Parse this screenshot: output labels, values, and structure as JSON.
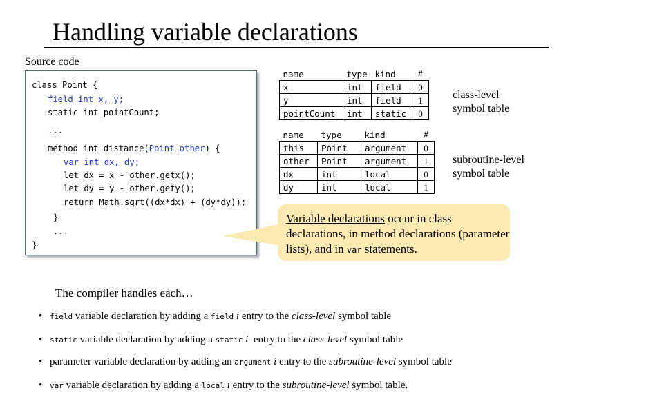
{
  "title": "Handling variable declarations",
  "source_label": "Source code",
  "code_lines": [
    "class Point {",
    "field int x, y;",
    "static int pointCount;",
    "...",
    "method int distance(",
    "Point other",
    ") {",
    "var int dx, dy;",
    "let dx = x - other.getx();",
    "let dy = y - other.gety();",
    "return Math.sqrt((dx*dx) + (dy*dy));",
    "}",
    "...",
    "}"
  ],
  "class_table": {
    "headers": [
      "name",
      "type",
      "kind",
      "#"
    ],
    "rows": [
      [
        "x",
        "int",
        "field",
        "0"
      ],
      [
        "y",
        "int",
        "field",
        "1"
      ],
      [
        "pointCount",
        "int",
        "static",
        "0"
      ]
    ],
    "label_line1": "class-level",
    "label_line2": "symbol table"
  },
  "sub_table": {
    "headers": [
      "name",
      "type",
      "kind",
      "#"
    ],
    "rows": [
      [
        "this",
        "Point",
        "argument",
        "0"
      ],
      [
        "other",
        "Point",
        "argument",
        "1"
      ],
      [
        "dx",
        "int",
        "local",
        "0"
      ],
      [
        "dy",
        "int",
        "local",
        "1"
      ]
    ],
    "label_line1": "subroutine-level",
    "label_line2": "symbol table"
  },
  "callout": {
    "underlined": "Variable declarations",
    "text1": " occur in class declarations, in method declarations (parameter lists), and in ",
    "code": "var",
    "text2": " statements.",
    "fill_color": "#fde9b2"
  },
  "intro": "The compiler handles each…",
  "bullets": [
    {
      "code1": "field",
      "t1": " variable declaration by adding a ",
      "code2": "field",
      "i": " i",
      "t2": " entry to the ",
      "em": "class-level",
      "t3": " symbol table"
    },
    {
      "code1": "static",
      "t1": " variable declaration by adding a ",
      "code2": "static",
      "i": " i",
      "t2": "  entry to the ",
      "em": "class-level",
      "t3": " symbol table"
    },
    {
      "code1": "",
      "t1": "parameter variable declaration by adding an ",
      "code2": "argument",
      "i": " i",
      "t2": " entry to the ",
      "em": "subroutine-level",
      "t3": " symbol table"
    },
    {
      "code1": "var",
      "t1": " variable declaration by adding a ",
      "code2": "local",
      "i": " i",
      "t2": " entry to the ",
      "em": "subroutine-level",
      "t3": " symbol table."
    }
  ],
  "colors": {
    "code_keyword_blue": "#1f35c8",
    "callout_fill": "#fde9b2"
  }
}
